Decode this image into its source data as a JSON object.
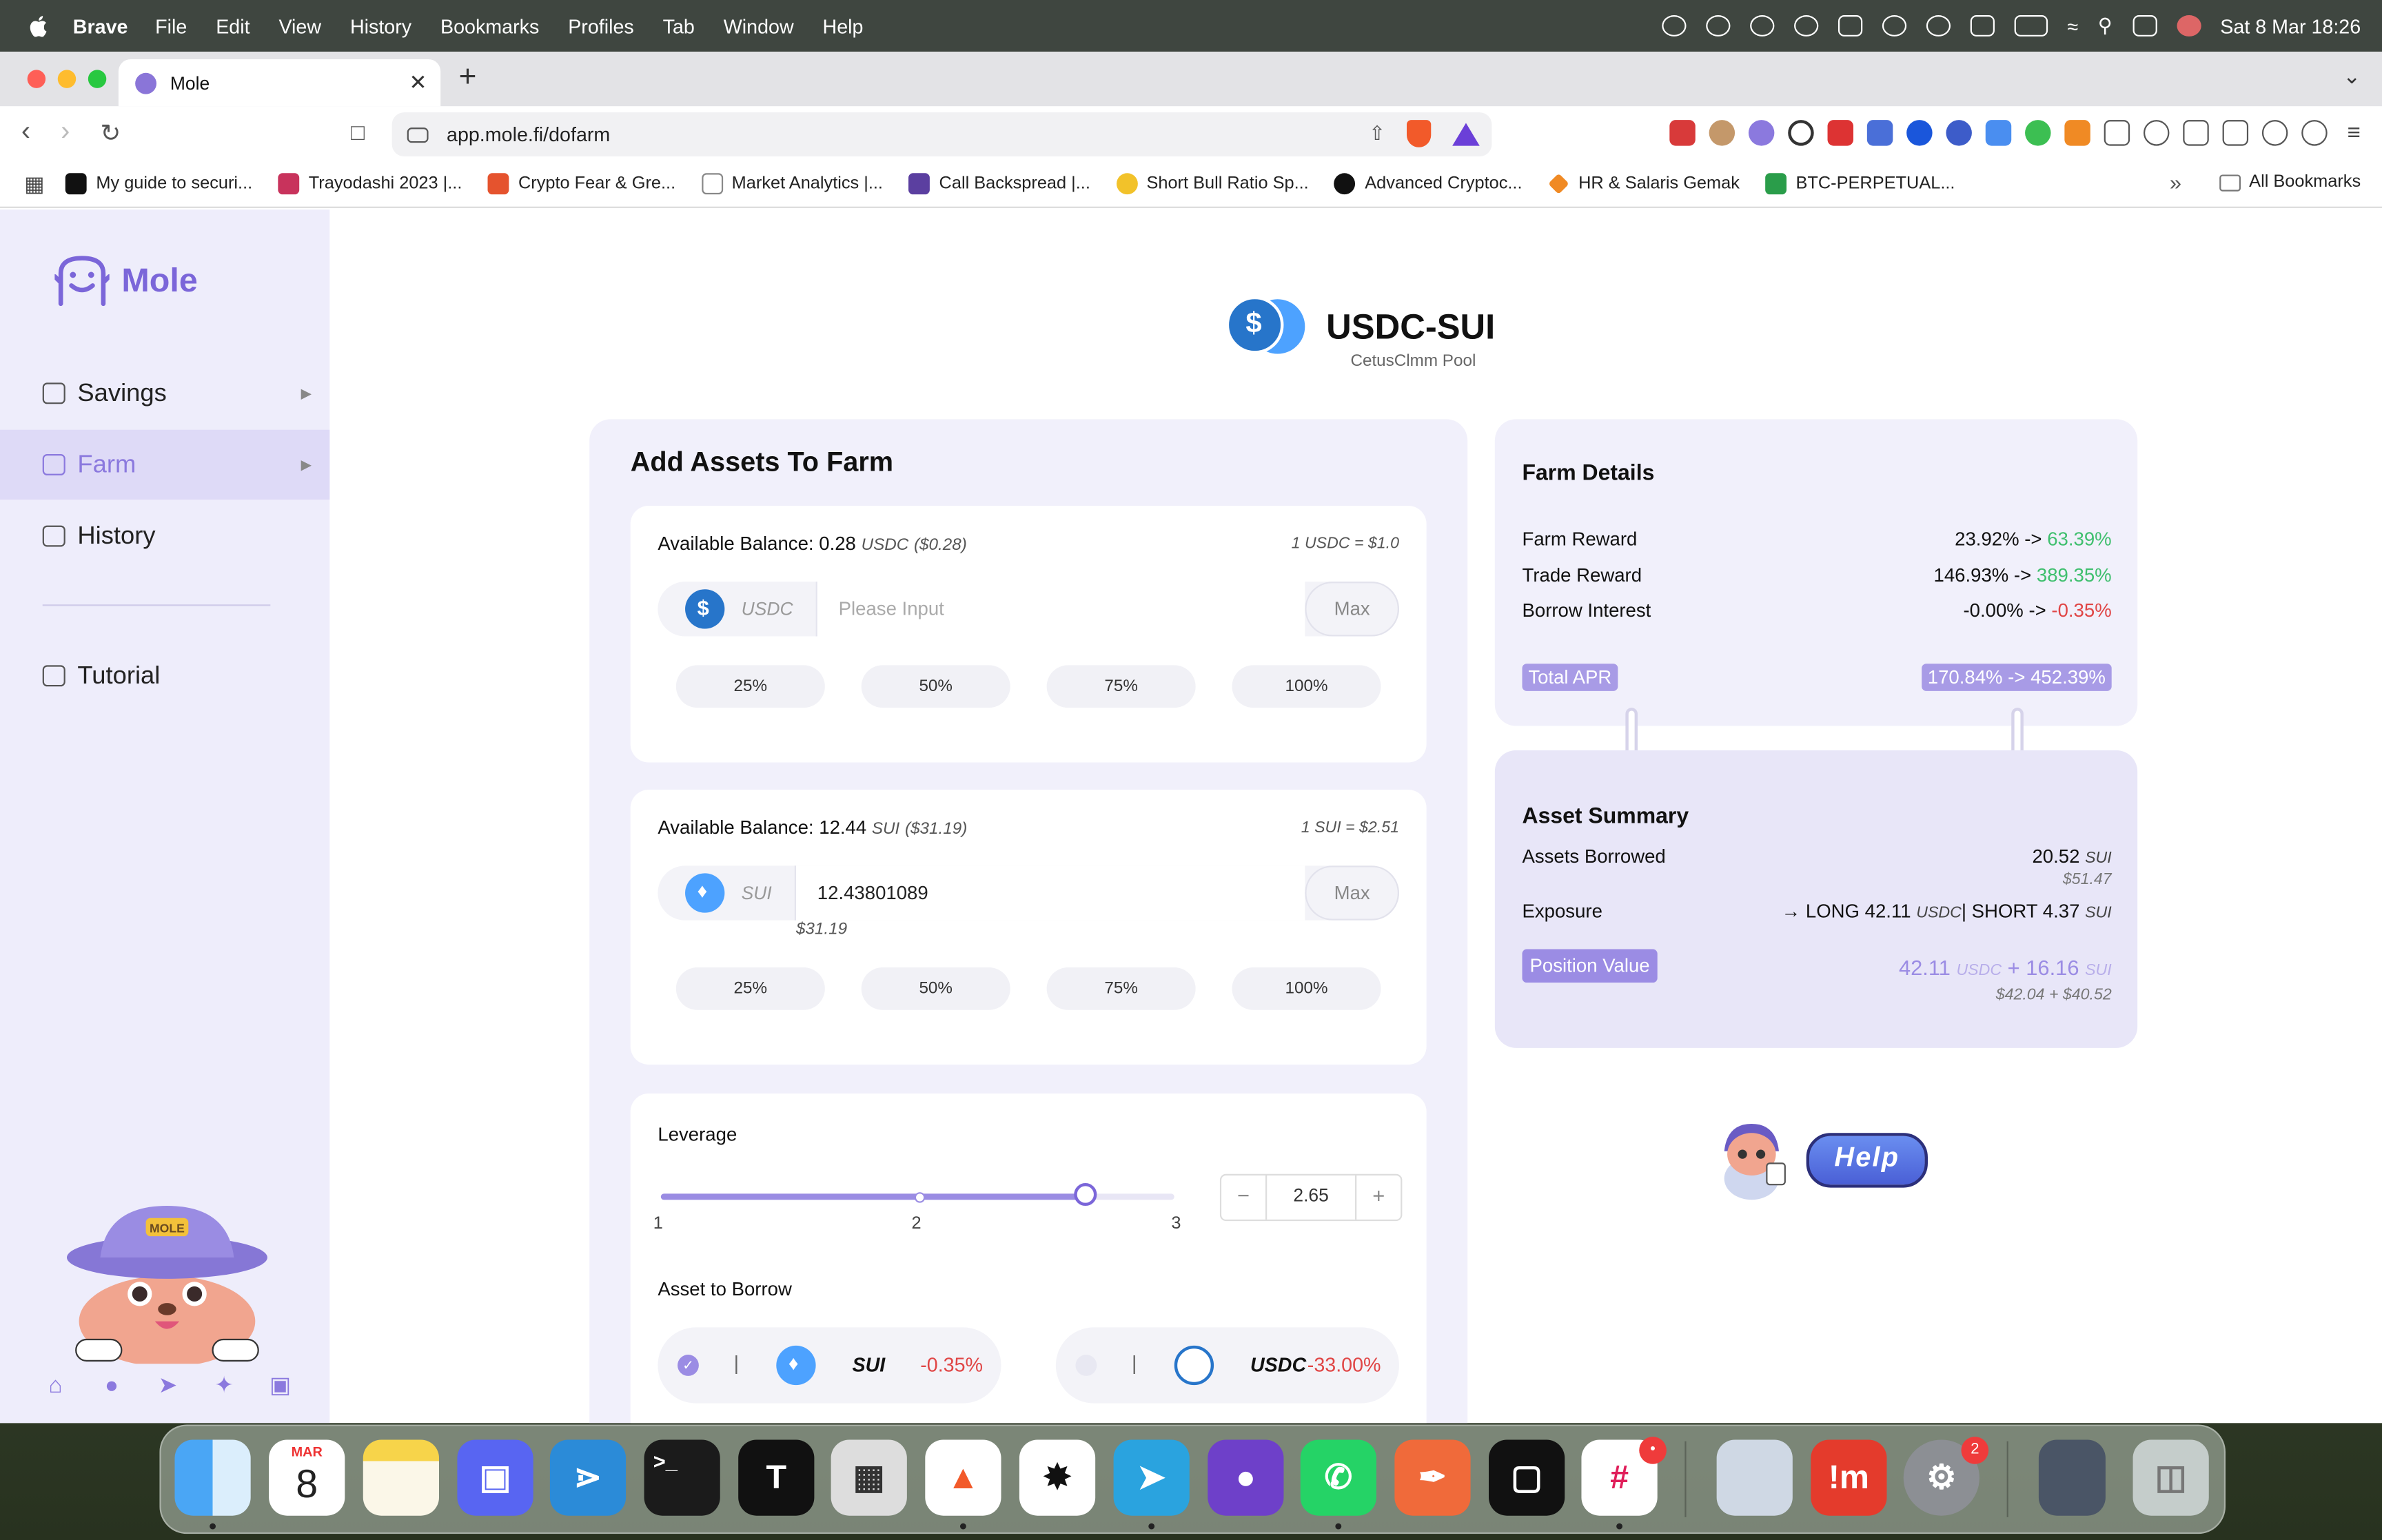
{
  "menubar": {
    "app": "Brave",
    "items": [
      "File",
      "Edit",
      "View",
      "History",
      "Bookmarks",
      "Profiles",
      "Tab",
      "Window",
      "Help"
    ],
    "datetime": "Sat 8 Mar  18:26"
  },
  "browser": {
    "tab_title": "Mole",
    "url": "app.mole.fi/dofarm",
    "bookmarks": [
      "My guide to securi...",
      "Trayodashi 2023 |...",
      "Crypto Fear & Gre...",
      "Market Analytics |...",
      "Call Backspread |...",
      "Short Bull Ratio Sp...",
      "Advanced Cryptoc...",
      "HR & Salaris Gemak",
      "BTC-PERPETUAL..."
    ],
    "all_bookmarks": "All Bookmarks"
  },
  "sidebar": {
    "logo": "Mole",
    "items": [
      {
        "label": "Savings",
        "icon": "savings-icon"
      },
      {
        "label": "Farm",
        "icon": "farm-icon"
      },
      {
        "label": "History",
        "icon": "history-icon"
      },
      {
        "label": "Tutorial",
        "icon": "folder-icon"
      }
    ],
    "mascot_hat_text": "MOLE"
  },
  "pool": {
    "title": "USDC-SUI",
    "subtitle": "CetusClmm Pool"
  },
  "add_assets": {
    "title": "Add Assets To Farm",
    "usdc": {
      "balance_label": "Available Balance:",
      "balance": "0.28",
      "symbol": "USDC",
      "balance_usd": "($0.28)",
      "rate": "1 USDC = $1.0",
      "input_placeholder": "Please Input",
      "input_value": "",
      "max": "Max"
    },
    "sui": {
      "balance_label": "Available Balance:",
      "balance": "12.44",
      "symbol": "SUI",
      "balance_usd": "($31.19)",
      "rate": "1 SUI = $2.51",
      "input_value": "12.43801089",
      "input_usd": "$31.19",
      "max": "Max"
    },
    "percents": [
      "25%",
      "50%",
      "75%",
      "100%"
    ],
    "leverage": {
      "label": "Leverage",
      "min_label": "1",
      "mid_label": "2",
      "max_label": "3",
      "value": "2.65",
      "value_num": 2.65,
      "minus": "−",
      "plus": "+"
    },
    "borrow": {
      "label": "Asset to Borrow",
      "options": [
        {
          "symbol": "SUI",
          "rate": "-0.35%",
          "selected": true
        },
        {
          "symbol": "USDC",
          "rate": "-33.00%",
          "selected": false
        }
      ]
    }
  },
  "farm_details": {
    "title": "Farm Details",
    "rows": [
      {
        "label": "Farm Reward",
        "from": "23.92% ->",
        "to": "63.39%",
        "to_color": "green"
      },
      {
        "label": "Trade Reward",
        "from": "146.93% ->",
        "to": "389.35%",
        "to_color": "green"
      },
      {
        "label": "Borrow Interest",
        "from": "-0.00% ->",
        "to": "-0.35%",
        "to_color": "red"
      }
    ],
    "total_apr_label": "Total APR",
    "total_apr_value": "170.84% -> 452.39%"
  },
  "asset_summary": {
    "title": "Asset Summary",
    "borrowed_label": "Assets Borrowed",
    "borrowed_value": "20.52",
    "borrowed_symbol": "SUI",
    "borrowed_usd": "$51.47",
    "exposure_label": "Exposure",
    "exposure_long": "LONG 42.11",
    "exposure_long_sym": "USDC",
    "exposure_sep": "|",
    "exposure_short": "SHORT 4.37",
    "exposure_short_sym": "SUI",
    "position_label": "Position Value",
    "position_a": "42.11",
    "position_a_sym": "USDC",
    "position_plus": "+",
    "position_b": "16.16",
    "position_b_sym": "SUI",
    "position_usd": "$42.04 + $40.52"
  },
  "help": {
    "label": "Help"
  },
  "dock": {
    "calendar_month": "MAR",
    "calendar_day": "8",
    "badges": {
      "slack": "•",
      "settings": "2"
    }
  }
}
